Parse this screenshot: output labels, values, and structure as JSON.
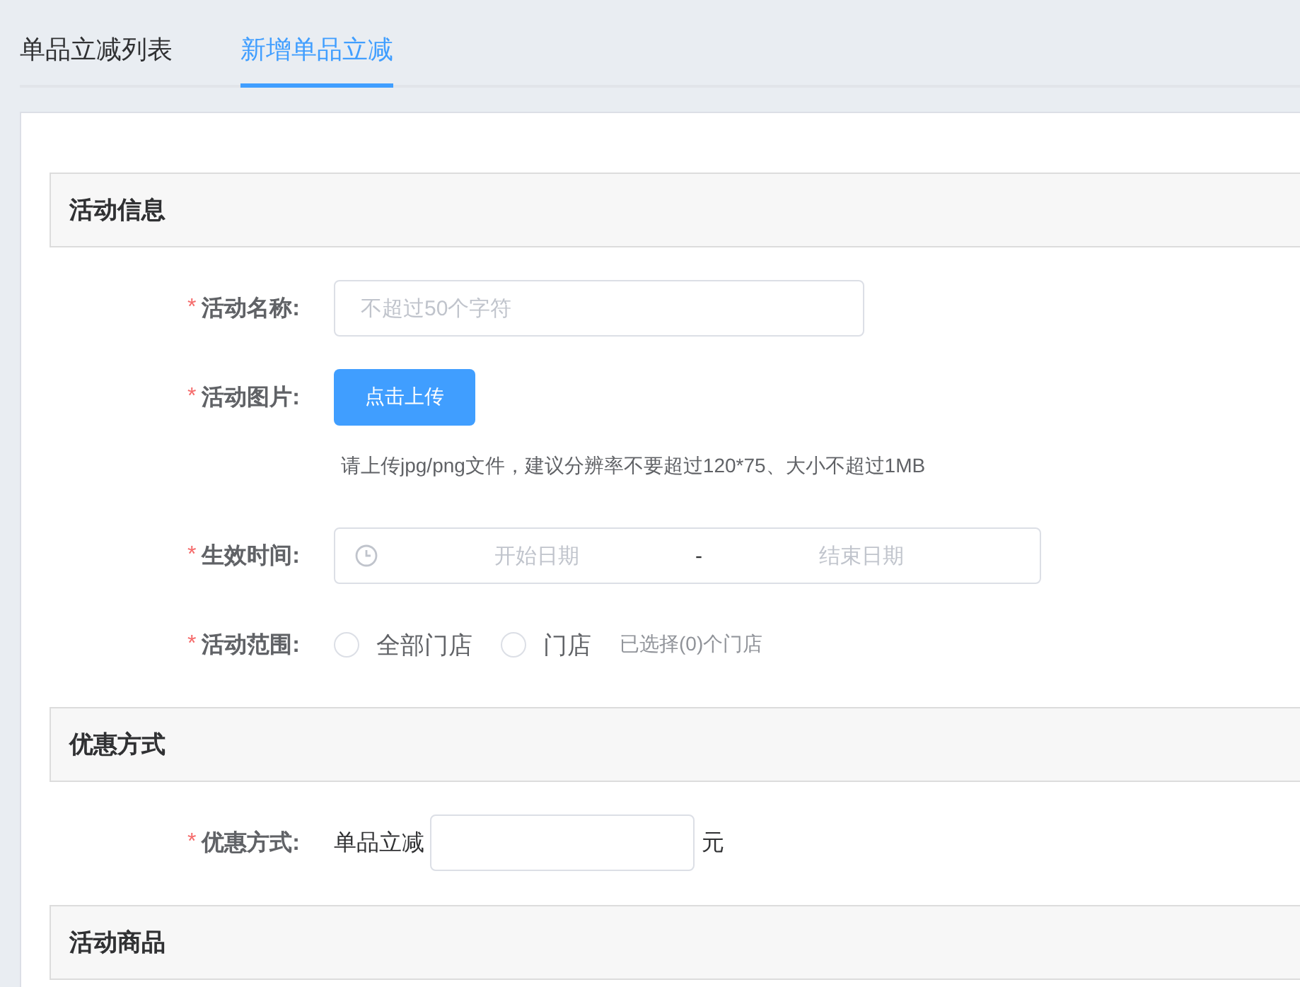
{
  "tabs": [
    {
      "label": "单品立减列表",
      "selected": false
    },
    {
      "label": "新增单品立减",
      "selected": true
    }
  ],
  "sections": [
    {
      "title": "活动信息",
      "fields": [
        {
          "kind": "text",
          "marker": "*",
          "label": "活动名称:",
          "placeholder": "不超过50个字符"
        },
        {
          "kind": "upload",
          "marker": "*",
          "label": "活动图片:",
          "button": "点击上传",
          "hint": "请上传jpg/png文件，建议分辨率不要超过120*75、大小不超过1MB"
        },
        {
          "kind": "daterange",
          "marker": "*",
          "label": "生效时间:",
          "start_placeholder": "开始日期",
          "separator": "-",
          "end_placeholder": "结束日期"
        },
        {
          "kind": "radio",
          "marker": "*",
          "label": "活动范围:",
          "options": [
            {
              "label": "全部门店",
              "selected": false
            },
            {
              "label": "门店",
              "selected": false
            }
          ],
          "note": "已选择(0)个门店"
        }
      ]
    },
    {
      "title": "优惠方式",
      "fields": [
        {
          "kind": "amount",
          "marker": "*",
          "label": "优惠方式:",
          "prefix": "单品立减",
          "suffix": "元"
        }
      ]
    },
    {
      "title": "活动商品"
    }
  ]
}
